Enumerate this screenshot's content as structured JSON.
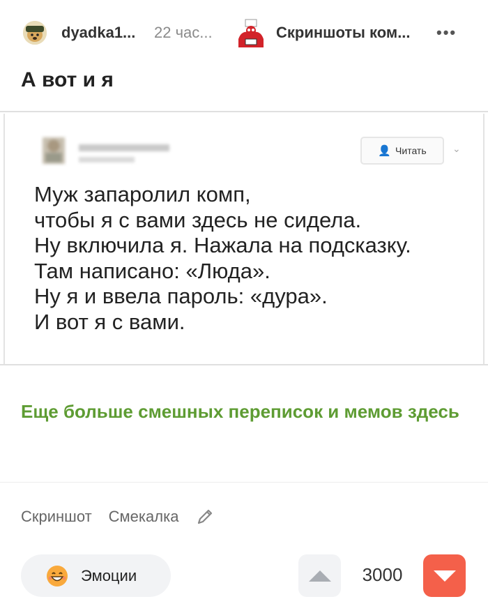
{
  "header": {
    "username": "dyadka1...",
    "time": "22 час...",
    "community": "Скриншоты ком...",
    "more_icon": "more-dots-icon"
  },
  "post": {
    "title": "А вот и я"
  },
  "tweet": {
    "follow_label": "Читать",
    "lines": [
      "Муж запаролил комп,",
      "чтобы я с вами здесь не сидела.",
      "Ну включила я. Нажала на подсказку.",
      "Там написано: «Люда».",
      "Ну я и ввела пароль: «дура».",
      "И вот я с вами."
    ]
  },
  "promo": {
    "text": "Еще больше смешных переписок и мемов здесь"
  },
  "tags": {
    "items": [
      "Скриншот",
      "Смекалка"
    ],
    "edit_icon": "pencil-icon"
  },
  "footer": {
    "emotions_label": "Эмоции",
    "rating": "3000",
    "colors": {
      "promo_green": "#5e9c33",
      "downvote_red": "#f4604a"
    }
  }
}
